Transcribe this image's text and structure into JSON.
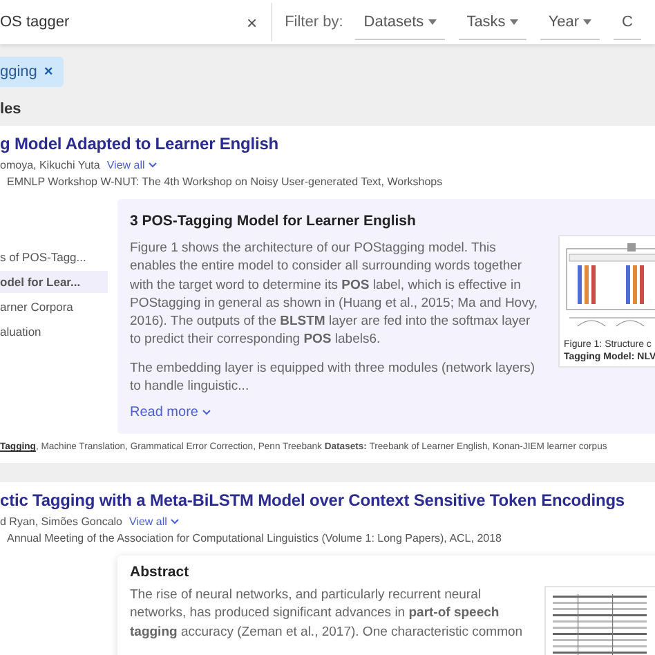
{
  "search": {
    "value": "OS tagger",
    "clear": "×"
  },
  "filters": {
    "label": "Filter by:",
    "items": [
      {
        "label": "Datasets",
        "caret": true
      },
      {
        "label": "Tasks",
        "caret": true
      },
      {
        "label": "Year",
        "caret": true
      },
      {
        "label": "C",
        "caret": false
      }
    ]
  },
  "active_filter": {
    "label": "gging",
    "remove": "×"
  },
  "section_label": "les",
  "results": [
    {
      "title": "g Model Adapted to Learner English",
      "authors": "omoya, Kikuchi Yuta",
      "view_all": "View all",
      "venue": "EMNLP Workshop W-NUT: The 4th Workshop on Noisy User-generated Text, Workshops",
      "outline": [
        {
          "label": "s of POS-Tagg...",
          "selected": false
        },
        {
          "label": "odel for Lear...",
          "selected": true
        },
        {
          "label": "arner Corpora",
          "selected": false
        },
        {
          "label": "aluation",
          "selected": false
        }
      ],
      "snippet": {
        "kind": "highlight",
        "heading": "3 POS-Tagging Model for Learner English",
        "paragraphs": [
          "Figure 1 shows the architecture of our POStagging model. This enables the entire model to consider all surrounding words together with the target word to determine its **POS** label, which is effective in POStagging in general as shown in (Huang et al., 2015; Ma and Hovy, 2016). The outputs of the **BLSTM** layer are fed into the softmax layer to predict their corresponding **POS** labels6.",
          "The embedding layer is equipped with three modules (network layers) to handle linguistic..."
        ],
        "read_more": "Read more"
      },
      "figure": {
        "kind": "diagram",
        "caption": [
          "Figure 1: Structure c",
          "Tagging Model: NLV"
        ]
      },
      "tasks_link": "Tagging",
      "tasks": ", Machine Translation, Grammatical Error Correction, Penn Treebank",
      "datasets_label": "Datasets:",
      "datasets": "Treebank of Learner English, Konan-JIEM learner corpus"
    },
    {
      "title": "ctic Tagging with a Meta-BiLSTM Model over Context Sensitive Token Encodings",
      "authors": "d Ryan, Simões Goncalo",
      "view_all": "View all",
      "venue": "Annual Meeting of the Association for Computational Linguistics (Volume 1: Long Papers), ACL, 2018",
      "snippet": {
        "kind": "plain",
        "heading": "Abstract",
        "paragraphs": [
          "The rise of neural networks, and particularly recurrent neural networks, has produced significant advances in **part-of speech tagging** accuracy (Zeman et al., 2017). One characteristic common"
        ]
      },
      "figure": {
        "kind": "table"
      }
    }
  ]
}
